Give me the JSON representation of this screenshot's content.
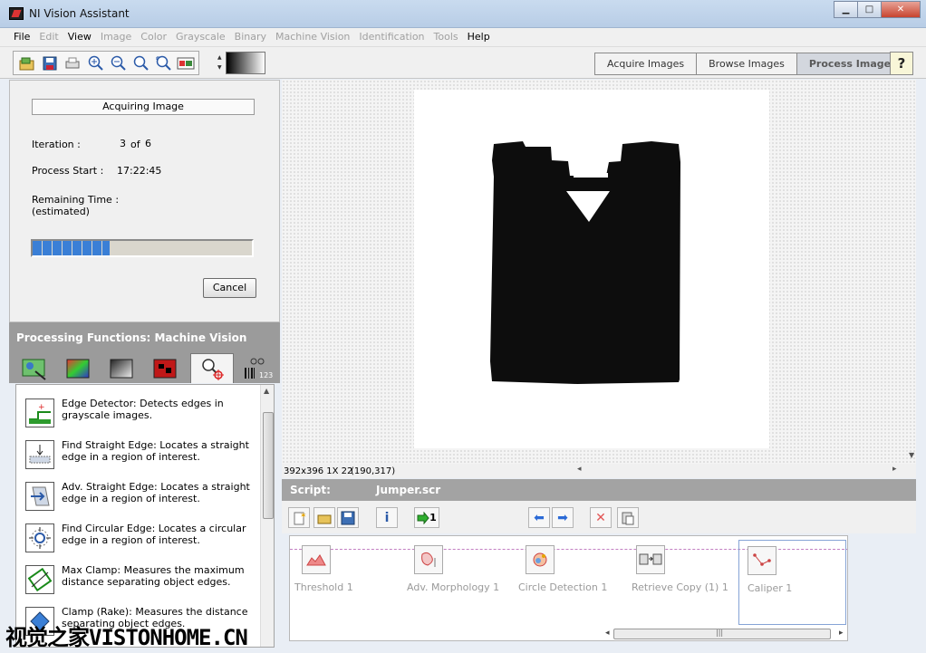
{
  "window": {
    "title": "NI Vision Assistant",
    "minimize": "▁",
    "maximize": "□",
    "close": "✕"
  },
  "menu": {
    "items": [
      {
        "label": "File",
        "enabled": true
      },
      {
        "label": "Edit",
        "enabled": false
      },
      {
        "label": "View",
        "enabled": true
      },
      {
        "label": "Image",
        "enabled": false
      },
      {
        "label": "Color",
        "enabled": false
      },
      {
        "label": "Grayscale",
        "enabled": false
      },
      {
        "label": "Binary",
        "enabled": false
      },
      {
        "label": "Machine Vision",
        "enabled": false
      },
      {
        "label": "Identification",
        "enabled": false
      },
      {
        "label": "Tools",
        "enabled": false
      },
      {
        "label": "Help",
        "enabled": true
      }
    ]
  },
  "toolbar": {
    "icons": [
      "open-image-icon",
      "save-image-icon",
      "print-icon",
      "zoom-in-icon",
      "zoom-out-icon",
      "zoom-1to1-icon",
      "zoom-fit-icon",
      "image-palette-icon"
    ],
    "modes": [
      {
        "label": "Acquire Images",
        "active": false
      },
      {
        "label": "Browse Images",
        "active": false
      },
      {
        "label": "Process Images",
        "active": true
      }
    ],
    "help_label": "?"
  },
  "acquisition": {
    "header": "Acquiring Image",
    "iteration_label": "Iteration :",
    "iteration_current": "3",
    "iteration_of": "of",
    "iteration_total": "6",
    "process_start_label": "Process Start :",
    "process_start_value": "17:22:45",
    "remaining_label": "Remaining Time :",
    "remaining_sub": "(estimated)",
    "progress_fraction": 0.35,
    "cancel_label": "Cancel"
  },
  "processing": {
    "header": "Processing Functions: Machine Vision",
    "tabs": [
      {
        "name": "image-tab-icon",
        "color": "#3b9b3b"
      },
      {
        "name": "color-tab-icon",
        "color": "#d84040"
      },
      {
        "name": "grayscale-tab-icon",
        "color": "#8a8a8a"
      },
      {
        "name": "binary-tab-icon",
        "color": "#c01818"
      },
      {
        "name": "machine-vision-tab-icon",
        "color": "#ffffff"
      },
      {
        "name": "identification-tab-icon",
        "color": "#666666"
      }
    ],
    "active_tab": 4,
    "tab_badge": "123",
    "functions": [
      {
        "name": "Edge Detector",
        "desc": "Edge Detector:  Detects edges in grayscale images.",
        "glyph": "⬚"
      },
      {
        "name": "Find Straight Edge",
        "desc": "Find Straight Edge:  Locates a straight edge in a region of interest.",
        "glyph": "↓"
      },
      {
        "name": "Adv. Straight Edge",
        "desc": "Adv. Straight Edge:  Locates a straight edge in a region of interest.",
        "glyph": "➚"
      },
      {
        "name": "Find Circular Edge",
        "desc": "Find Circular Edge:  Locates a circular edge in a region of interest.",
        "glyph": "◎"
      },
      {
        "name": "Max Clamp",
        "desc": "Max Clamp:  Measures the maximum distance separating object edges.",
        "glyph": "⤡"
      },
      {
        "name": "Clamp (Rake)",
        "desc": "Clamp (Rake):  Measures the distance separating object edges.",
        "glyph": "◆"
      }
    ]
  },
  "image_view": {
    "status_size": "392x396 1X 22",
    "status_coord": "(190,317)"
  },
  "script": {
    "label": "Script:",
    "filename": "Jumper.scr",
    "toolbar_icons": [
      "new-script-icon",
      "open-script-icon",
      "save-script-icon",
      "info-icon",
      "run-once-icon",
      "step-back-icon",
      "step-forward-icon",
      "delete-step-icon",
      "paste-step-icon"
    ],
    "run_label": "1",
    "steps": [
      {
        "label": "Threshold 1",
        "glyph": "◭"
      },
      {
        "label": "Adv. Morphology 1",
        "glyph": "✿"
      },
      {
        "label": "Circle Detection 1",
        "glyph": "◉"
      },
      {
        "label": "Retrieve Copy (1) 1",
        "glyph": "⇆"
      },
      {
        "label": "Caliper 1",
        "glyph": "⟋"
      }
    ],
    "selected_step": 4,
    "scroll_grip": "|||"
  },
  "watermark": "视觉之家VISTONHOME.CN"
}
